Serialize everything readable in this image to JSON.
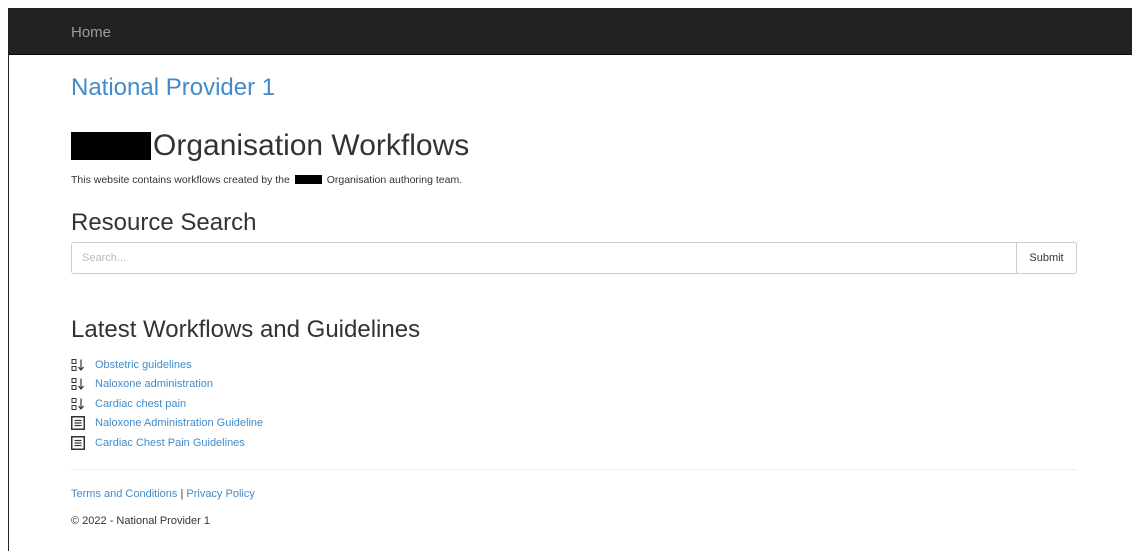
{
  "navbar": {
    "home_label": "Home"
  },
  "provider_name": "National Provider 1",
  "page": {
    "title": "Organisation Workflows",
    "intro_before": "This website contains workflows created by the",
    "intro_after": "Organisation authoring team."
  },
  "search": {
    "heading": "Resource Search",
    "placeholder": "Search...",
    "submit_label": "Submit"
  },
  "latest": {
    "heading": "Latest Workflows and Guidelines",
    "items": [
      {
        "label": "Obstetric guidelines",
        "icon": "workflow-icon"
      },
      {
        "label": "Naloxone administration",
        "icon": "workflow-icon"
      },
      {
        "label": "Cardiac chest pain",
        "icon": "workflow-icon"
      },
      {
        "label": "Naloxone Administration Guideline",
        "icon": "document-icon"
      },
      {
        "label": "Cardiac Chest Pain Guidelines",
        "icon": "document-icon"
      }
    ]
  },
  "footer": {
    "terms_label": "Terms and Conditions",
    "separator": "|",
    "privacy_label": "Privacy Policy",
    "copyright": "© 2022 - National Provider 1"
  },
  "colors": {
    "navbar_bg": "#222222",
    "link": "#428bca",
    "redaction": "#000000"
  }
}
